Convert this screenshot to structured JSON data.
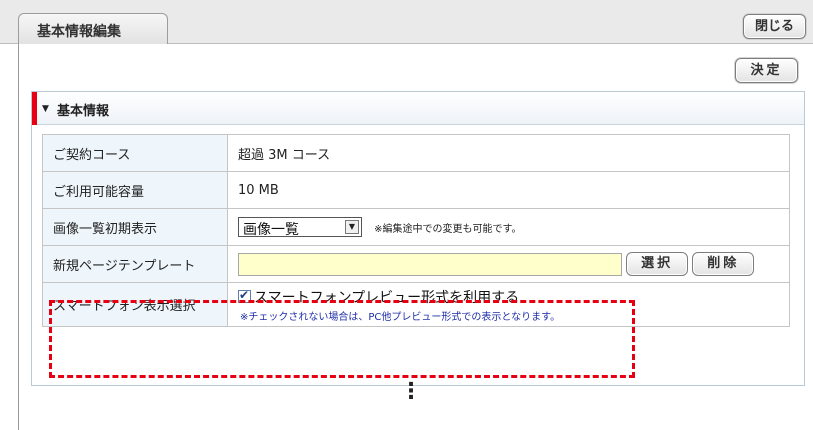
{
  "tab": {
    "label": "基本情報編集"
  },
  "buttons": {
    "close": "閉じる",
    "decide": "決定"
  },
  "section": {
    "title": "基本情報"
  },
  "rows": [
    {
      "label": "ご契約コース",
      "value": "超過 3M コース"
    },
    {
      "label": "ご利用可能容量",
      "value": "10 MB"
    },
    {
      "label": "画像一覧初期表示",
      "select_value": "画像一覧",
      "note": "※編集途中での変更も可能です。"
    },
    {
      "label": "新規ページテンプレート",
      "input_value": "",
      "select_button": "選択",
      "delete_button": "削除"
    },
    {
      "label": "スマートフォン表示選択",
      "checkbox_label": "スマートフォンプレビュー形式を利用する",
      "checked": true,
      "subnote": "※チェックされない場合は、PC他プレビュー形式での表示となります。"
    }
  ],
  "more_indicator": "⋮",
  "colors": {
    "accent_red": "#e60012",
    "label_bg": "#eef5fb",
    "input_bg": "#ffffcc"
  }
}
